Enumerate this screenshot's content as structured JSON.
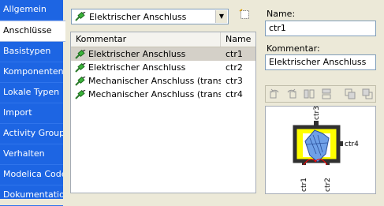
{
  "nav": {
    "items": [
      {
        "label": "Allgemein"
      },
      {
        "label": "Anschlüsse",
        "active": true
      },
      {
        "label": "Basistypen"
      },
      {
        "label": "Komponenten"
      },
      {
        "label": "Lokale Typen"
      },
      {
        "label": "Import"
      },
      {
        "label": "Activity Groups"
      },
      {
        "label": "Verhalten"
      },
      {
        "label": "Modelica Code"
      },
      {
        "label": "Dokumentation"
      }
    ]
  },
  "connector_filter": {
    "selected": "Elektrischer Anschluss",
    "icon": "electrical-connector-icon"
  },
  "new_button": {
    "icon": "new-item-icon"
  },
  "table": {
    "columns": [
      "Kommentar",
      "Name"
    ],
    "rows": [
      {
        "comment": "Elektrischer Anschluss",
        "name": "ctr1",
        "selected": true
      },
      {
        "comment": "Elektrischer Anschluss",
        "name": "ctr2"
      },
      {
        "comment": "Mechanischer Anschluss (transl...",
        "name": "ctr3"
      },
      {
        "comment": "Mechanischer Anschluss (transl...",
        "name": "ctr4"
      }
    ]
  },
  "details": {
    "name_label": "Name:",
    "name_value": "ctr1",
    "comment_label": "Kommentar:",
    "comment_value": "Elektrischer Anschluss"
  },
  "toolbar": {
    "icons": [
      "rotate-left-icon",
      "rotate-right-icon",
      "flip-horizontal-icon",
      "flip-vertical-icon",
      "bring-front-icon",
      "send-back-icon"
    ]
  },
  "diagram": {
    "ports": [
      "ctr3",
      "ctr4",
      "ctr1",
      "ctr2"
    ],
    "colors": {
      "body": "#ffff00",
      "frame": "#404040",
      "shape": "#6fa0e8",
      "wire": "#ff0000"
    }
  }
}
